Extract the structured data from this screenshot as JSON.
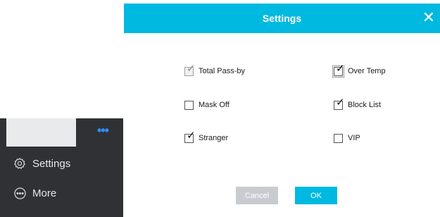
{
  "dialog": {
    "title": "Settings",
    "close_glyph": "✕",
    "options": [
      {
        "key": "total_pass_by",
        "label": "Total Pass-by",
        "checked": true,
        "state": "disabled"
      },
      {
        "key": "over_temp",
        "label": "Over Temp",
        "checked": true,
        "state": "focused"
      },
      {
        "key": "mask_off",
        "label": "Mask Off",
        "checked": false,
        "state": "normal"
      },
      {
        "key": "block_list",
        "label": "Block List",
        "checked": true,
        "state": "normal"
      },
      {
        "key": "stranger",
        "label": "Stranger",
        "checked": true,
        "state": "normal"
      },
      {
        "key": "vip",
        "label": "VIP",
        "checked": false,
        "state": "normal"
      }
    ],
    "cancel_label": "Cancel",
    "ok_label": "OK"
  },
  "sidebar": {
    "more_dots": "•••",
    "items": [
      {
        "label": "Settings",
        "icon": "gear-icon"
      },
      {
        "label": "More",
        "icon": "more-circle-icon"
      }
    ]
  },
  "colors": {
    "accent": "#00b9e0",
    "panel": "#2f3135",
    "dots": "#2f8df5",
    "disabled_button": "#c8cbcf"
  }
}
